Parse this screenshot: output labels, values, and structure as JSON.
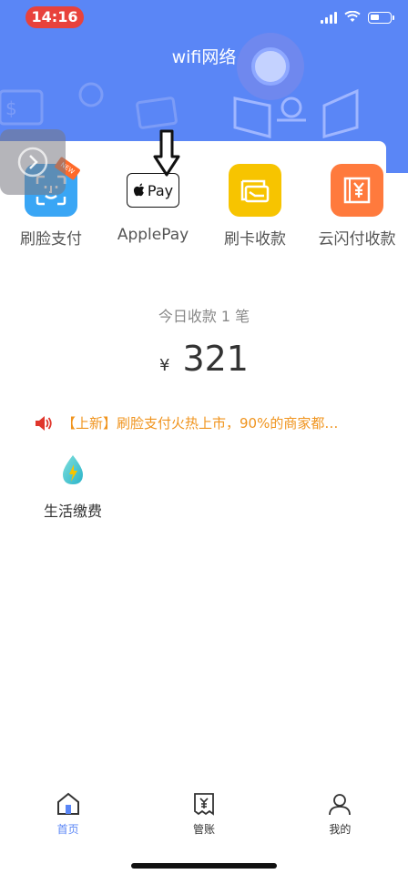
{
  "status_bar": {
    "time": "14:16",
    "battery_level": 0.45
  },
  "header": {
    "title": "wifi网络"
  },
  "quick_actions": [
    {
      "label": "刷脸支付",
      "icon": "face-scan-icon",
      "badge": "NEW",
      "color": "#3aa6f5"
    },
    {
      "label": "ApplePay",
      "icon": "apple-pay-icon",
      "badge_text": "Pay",
      "color": "#ffffff"
    },
    {
      "label": "刷卡收款",
      "icon": "card-swipe-icon",
      "color": "#f7c400"
    },
    {
      "label": "云闪付收款",
      "icon": "yuan-receipt-icon",
      "color": "#ff7a3d"
    }
  ],
  "summary": {
    "label": "今日收款 1 笔",
    "currency": "¥",
    "amount": "321"
  },
  "notice": {
    "text": "【上新】刷脸支付火热上市，90%的商家都…",
    "icon": "speaker-icon"
  },
  "services": [
    {
      "label": "生活缴费",
      "icon": "water-drop-icon"
    }
  ],
  "tabbar": [
    {
      "label": "首页",
      "icon": "home-icon",
      "active": true
    },
    {
      "label": "管账",
      "icon": "ledger-icon",
      "active": false
    },
    {
      "label": "我的",
      "icon": "profile-icon",
      "active": false
    }
  ],
  "colors": {
    "accent": "#5a86f6",
    "notice": "#f0941e",
    "time_pill": "#e8423c"
  }
}
